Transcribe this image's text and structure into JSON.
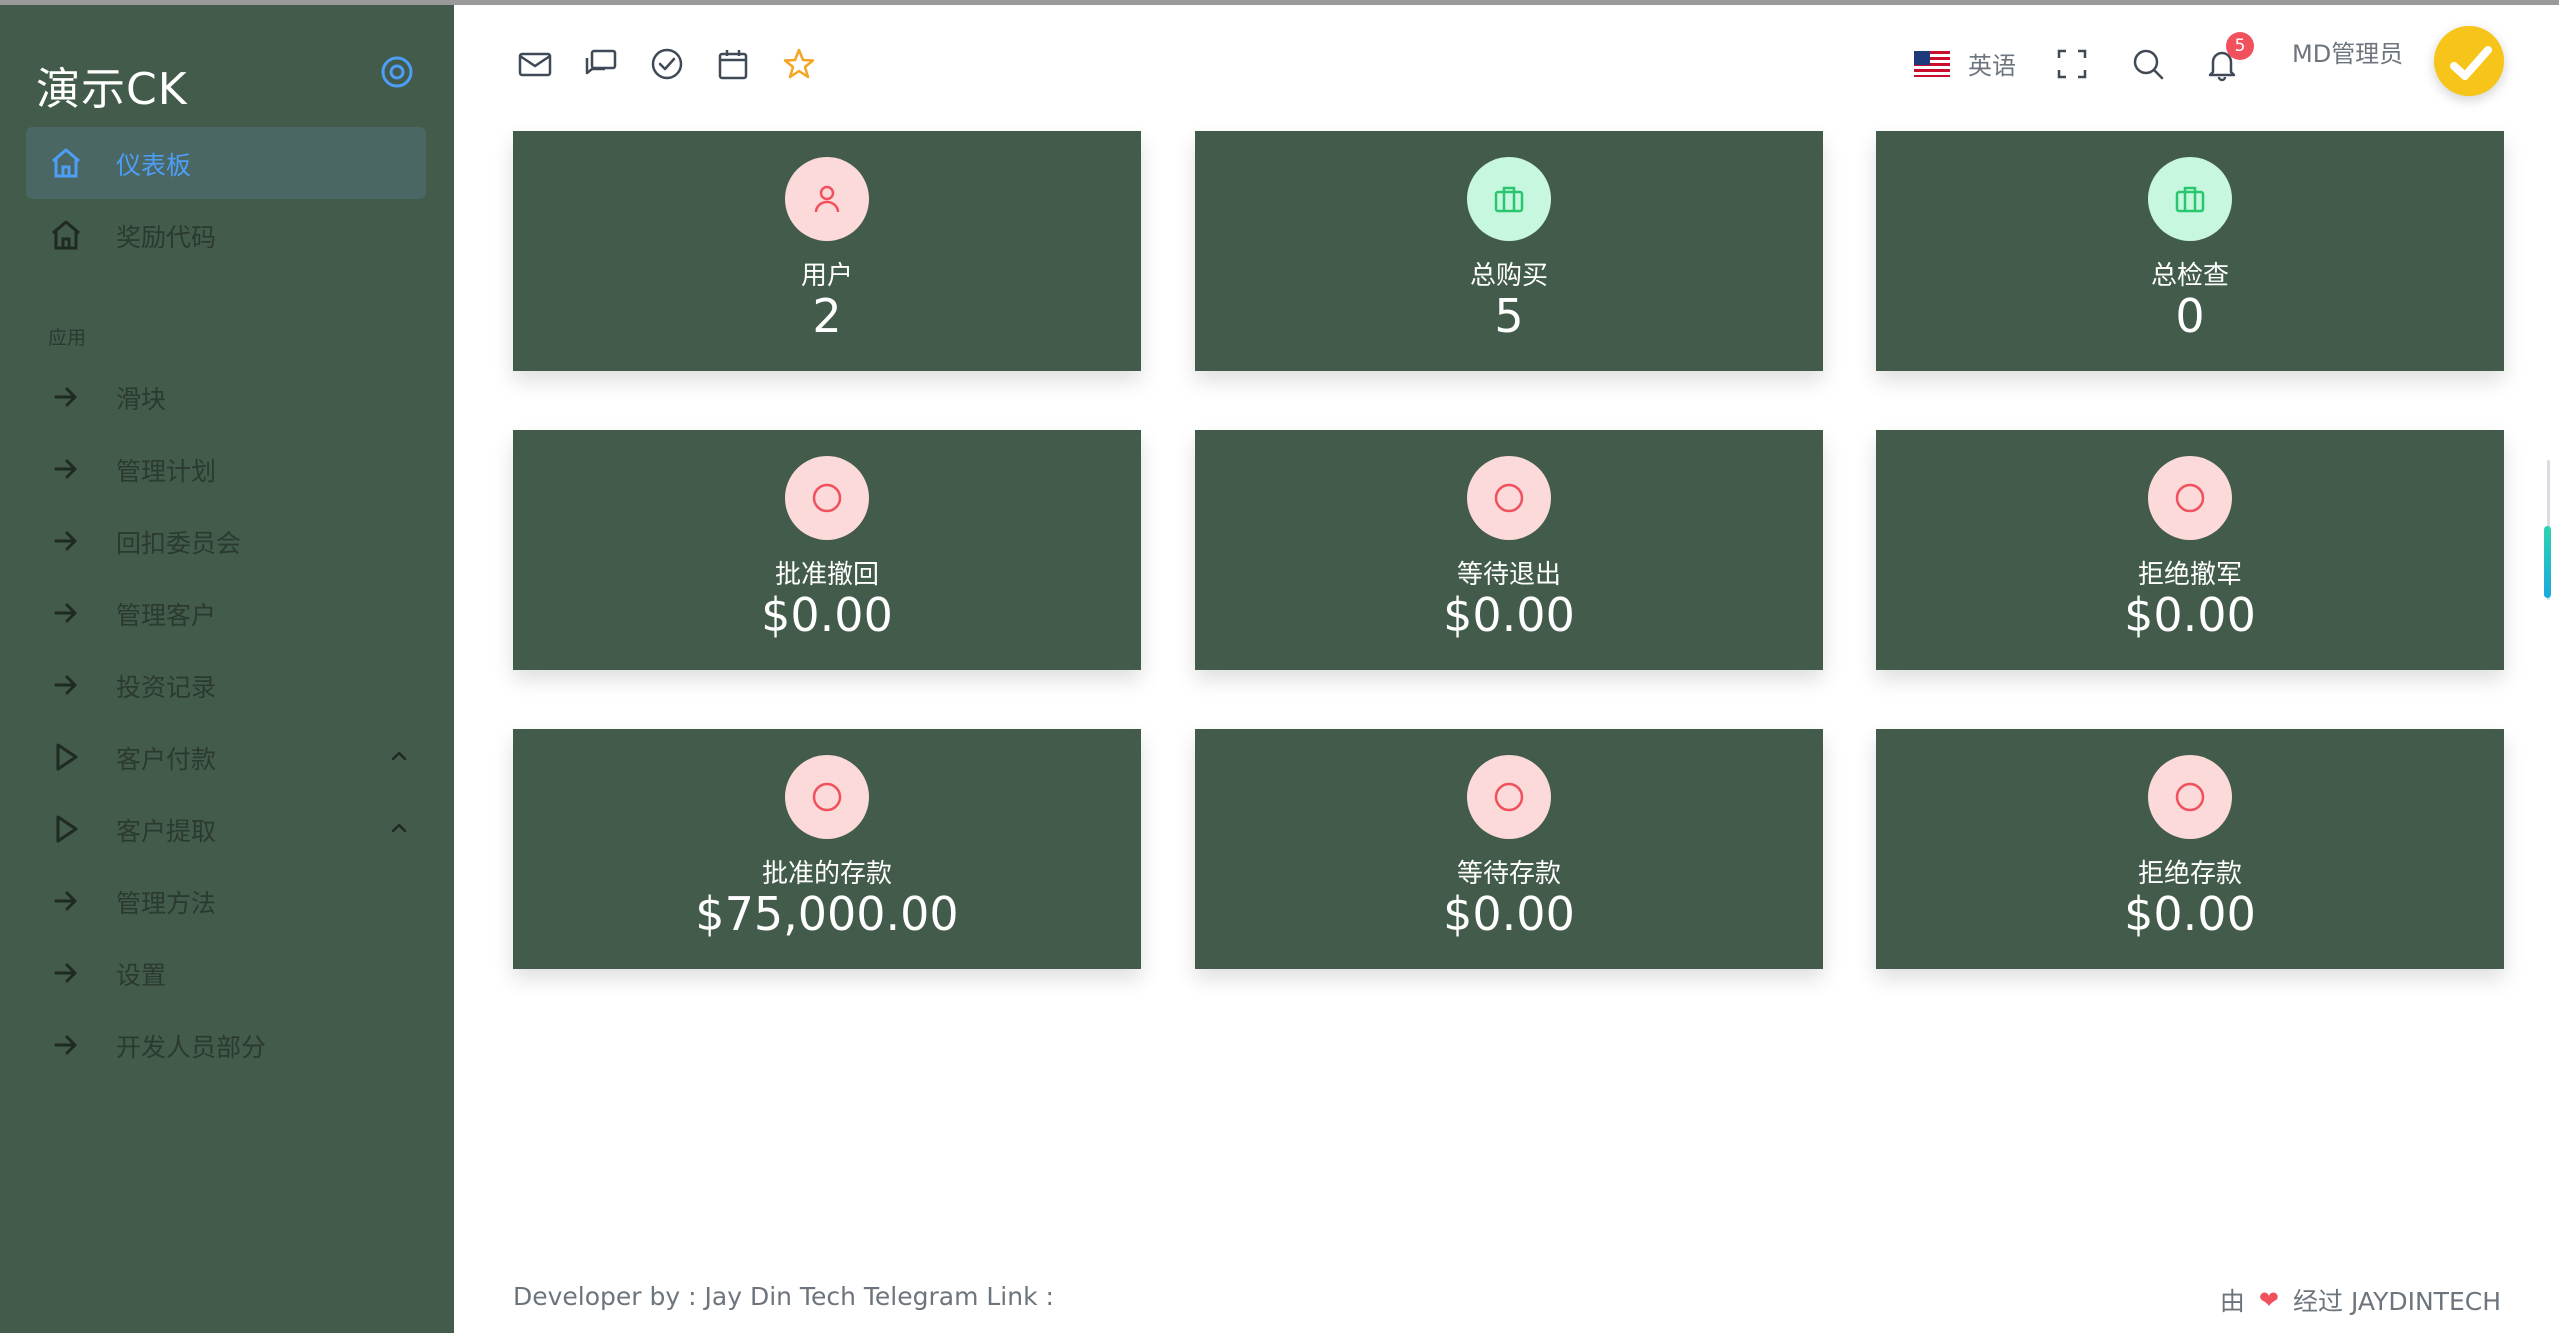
{
  "brand": {
    "title": "演示CK"
  },
  "sidebar": {
    "section_label": "应用",
    "items": [
      {
        "label": "仪表板",
        "icon": "home-icon",
        "active": true
      },
      {
        "label": "奖励代码",
        "icon": "home-icon"
      },
      {
        "label": "滑块",
        "icon": "arrow-right-icon"
      },
      {
        "label": "管理计划",
        "icon": "arrow-right-icon"
      },
      {
        "label": "回扣委员会",
        "icon": "arrow-right-icon"
      },
      {
        "label": "管理客户",
        "icon": "arrow-right-icon"
      },
      {
        "label": "投资记录",
        "icon": "arrow-right-icon"
      },
      {
        "label": "客户付款",
        "icon": "play-icon",
        "expandable": true
      },
      {
        "label": "客户提取",
        "icon": "play-icon",
        "expandable": true
      },
      {
        "label": "管理方法",
        "icon": "arrow-right-icon"
      },
      {
        "label": "设置",
        "icon": "arrow-right-icon"
      },
      {
        "label": "开发人员部分",
        "icon": "arrow-right-icon"
      }
    ]
  },
  "header": {
    "icons": [
      "mail-icon",
      "chat-icon",
      "check-circle-icon",
      "calendar-icon",
      "star-icon"
    ],
    "language": "英语",
    "notification_count": "5",
    "user_name": "MD管理员"
  },
  "cards": [
    {
      "title": "用户",
      "value": "2",
      "icon": "user-icon",
      "tone": "pink"
    },
    {
      "title": "总购买",
      "value": "5",
      "icon": "briefcase-icon",
      "tone": "green"
    },
    {
      "title": "总检查",
      "value": "0",
      "icon": "briefcase-icon",
      "tone": "green"
    },
    {
      "title": "批准撤回",
      "value": "$0.00",
      "icon": "circle-icon",
      "tone": "pink"
    },
    {
      "title": "等待退出",
      "value": "$0.00",
      "icon": "circle-icon",
      "tone": "pink"
    },
    {
      "title": "拒绝撤军",
      "value": "$0.00",
      "icon": "circle-icon",
      "tone": "pink"
    },
    {
      "title": "批准的存款",
      "value": "$75,000.00",
      "icon": "circle-icon",
      "tone": "pink"
    },
    {
      "title": "等待存款",
      "value": "$0.00",
      "icon": "circle-icon",
      "tone": "pink"
    },
    {
      "title": "拒绝存款",
      "value": "$0.00",
      "icon": "circle-icon",
      "tone": "pink"
    }
  ],
  "footer": {
    "left": "Developer by : Jay Din Tech Telegram Link :",
    "right_prefix": "由",
    "right_suffix": "经过 JAYDINTECH"
  },
  "colors": {
    "sidebar_bg": "#425b4a",
    "card_bg": "#425b4a",
    "accent": "#4d9ef7",
    "badge": "#f0515d"
  }
}
